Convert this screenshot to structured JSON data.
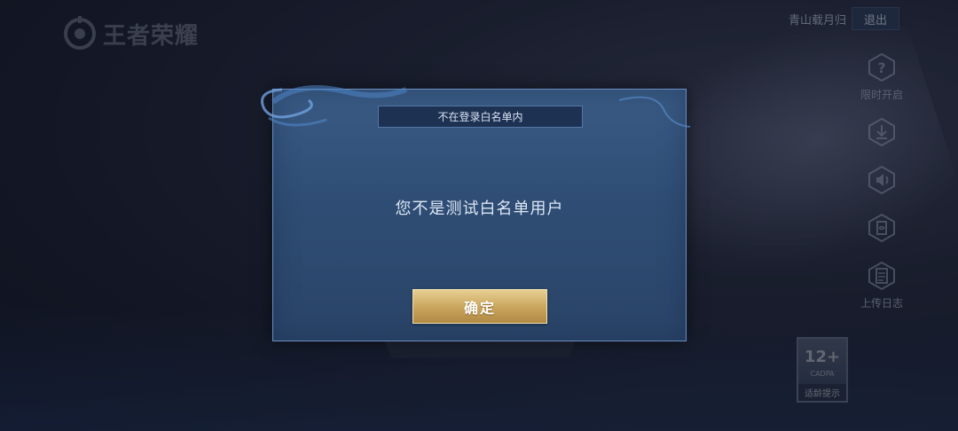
{
  "app": {
    "logo_text": "王者荣耀"
  },
  "header": {
    "username": "青山载月归",
    "logout_label": "退出"
  },
  "side_tools": [
    {
      "icon": "question-icon",
      "label": "限时开启"
    },
    {
      "icon": "download-icon",
      "label": ""
    },
    {
      "icon": "speaker-icon",
      "label": ""
    },
    {
      "icon": "repair-icon",
      "label": ""
    },
    {
      "icon": "log-icon",
      "label": "上传日志"
    }
  ],
  "age_rating": {
    "value": "12+",
    "org": "CADPA",
    "tip": "适龄提示"
  },
  "modal": {
    "title": "不在登录白名单内",
    "message": "您不是测试白名单用户",
    "confirm_label": "确定"
  },
  "colors": {
    "modal_bg": "#2f4d74",
    "modal_border": "#6a8fc0",
    "confirm_gold": "#c9a45b"
  }
}
